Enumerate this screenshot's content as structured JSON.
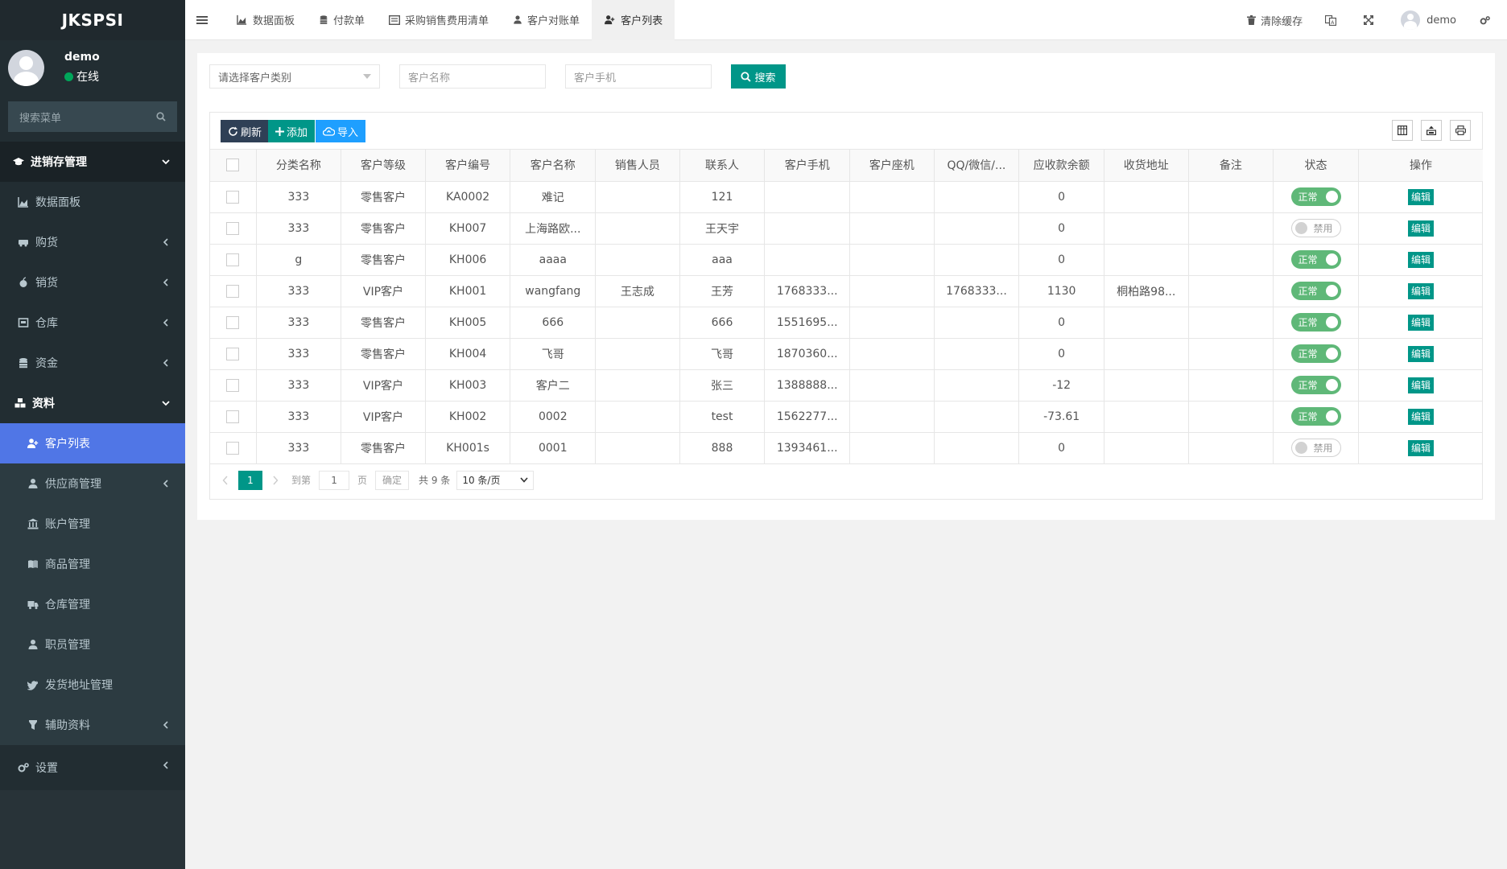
{
  "app": {
    "logo": "JKSPSI"
  },
  "user": {
    "name": "demo",
    "status": "在线"
  },
  "sidebar": {
    "search_placeholder": "搜索菜单",
    "items": [
      {
        "label": "进销存管理"
      },
      {
        "label": "数据面板"
      },
      {
        "label": "购货"
      },
      {
        "label": "销货"
      },
      {
        "label": "仓库"
      },
      {
        "label": "资金"
      },
      {
        "label": "资料"
      },
      {
        "label": "客户列表"
      },
      {
        "label": "供应商管理"
      },
      {
        "label": "账户管理"
      },
      {
        "label": "商品管理"
      },
      {
        "label": "仓库管理"
      },
      {
        "label": "职员管理"
      },
      {
        "label": "发货地址管理"
      },
      {
        "label": "辅助资料"
      },
      {
        "label": "设置"
      }
    ]
  },
  "topbar": {
    "tabs": [
      "数据面板",
      "付款单",
      "采购销售费用清单",
      "客户对账单",
      "客户列表"
    ],
    "clear_cache": "清除缓存",
    "user": "demo"
  },
  "filters": {
    "category_placeholder": "请选择客户类别",
    "name_placeholder": "客户名称",
    "phone_placeholder": "客户手机",
    "search_label": "搜索"
  },
  "toolbar": {
    "refresh": "刷新",
    "add": "添加",
    "import": "导入"
  },
  "table": {
    "columns": [
      "分类名称",
      "客户等级",
      "客户编号",
      "客户名称",
      "销售人员",
      "联系人",
      "客户手机",
      "客户座机",
      "QQ/微信/...",
      "应收款余额",
      "收货地址",
      "备注",
      "状态",
      "操作"
    ],
    "edit_label": "编辑",
    "status_on": "正常",
    "status_off": "禁用",
    "rows": [
      {
        "cat": "333",
        "level": "零售客户",
        "code": "KA0002",
        "name": "难记",
        "sales": "",
        "contact": "121",
        "mobile": "",
        "tel": "",
        "qq": "",
        "balance": "0",
        "addr": "",
        "note": "",
        "on": true
      },
      {
        "cat": "333",
        "level": "零售客户",
        "code": "KH007",
        "name": "上海路欧...",
        "sales": "",
        "contact": "王天宇",
        "mobile": "",
        "tel": "",
        "qq": "",
        "balance": "0",
        "addr": "",
        "note": "",
        "on": false
      },
      {
        "cat": "g",
        "level": "零售客户",
        "code": "KH006",
        "name": "aaaa",
        "sales": "",
        "contact": "aaa",
        "mobile": "",
        "tel": "",
        "qq": "",
        "balance": "0",
        "addr": "",
        "note": "",
        "on": true
      },
      {
        "cat": "333",
        "level": "VIP客户",
        "code": "KH001",
        "name": "wangfang",
        "sales": "王志成",
        "contact": "王芳",
        "mobile": "1768333...",
        "tel": "",
        "qq": "1768333...",
        "balance": "1130",
        "addr": "桐柏路98...",
        "note": "",
        "on": true
      },
      {
        "cat": "333",
        "level": "零售客户",
        "code": "KH005",
        "name": "666",
        "sales": "",
        "contact": "666",
        "mobile": "1551695...",
        "tel": "",
        "qq": "",
        "balance": "0",
        "addr": "",
        "note": "",
        "on": true
      },
      {
        "cat": "333",
        "level": "零售客户",
        "code": "KH004",
        "name": "飞哥",
        "sales": "",
        "contact": "飞哥",
        "mobile": "1870360...",
        "tel": "",
        "qq": "",
        "balance": "0",
        "addr": "",
        "note": "",
        "on": true
      },
      {
        "cat": "333",
        "level": "VIP客户",
        "code": "KH003",
        "name": "客户二",
        "sales": "",
        "contact": "张三",
        "mobile": "1388888...",
        "tel": "",
        "qq": "",
        "balance": "-12",
        "addr": "",
        "note": "",
        "on": true
      },
      {
        "cat": "333",
        "level": "VIP客户",
        "code": "KH002",
        "name": "0002",
        "sales": "",
        "contact": "test",
        "mobile": "1562277...",
        "tel": "",
        "qq": "",
        "balance": "-73.61",
        "addr": "",
        "note": "",
        "on": true
      },
      {
        "cat": "333",
        "level": "零售客户",
        "code": "KH001s",
        "name": "0001",
        "sales": "",
        "contact": "888",
        "mobile": "1393461...",
        "tel": "",
        "qq": "",
        "balance": "0",
        "addr": "",
        "note": "",
        "on": false
      }
    ]
  },
  "pager": {
    "current": "1",
    "goto": "到第",
    "page_input": "1",
    "page": "页",
    "confirm": "确定",
    "total": "共 9 条",
    "page_size": "10 条/页"
  }
}
